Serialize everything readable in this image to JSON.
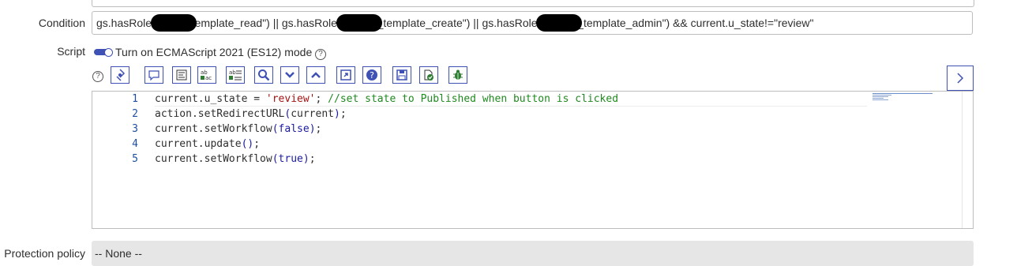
{
  "condition": {
    "label": "Condition",
    "seg1": "gs.hasRole(",
    "seg2": "template_read\") || gs.hasRole(",
    "seg3": "_template_create\") || gs.hasRole(",
    "seg4": "_template_admin\") && current.u_state!=\"review\""
  },
  "script": {
    "label": "Script",
    "es_mode_label": "Turn on ECMAScript 2021 (ES12) mode",
    "es_mode_enabled": true,
    "help_glyph": "?"
  },
  "toolbar": {
    "icons": [
      "toggle-syntax-icon",
      "comment-icon",
      "format-icon",
      "replace-icon",
      "replace-all-icon",
      "search-icon",
      "next-icon",
      "previous-icon",
      "fullscreen-icon",
      "help-icon",
      "save-icon",
      "script-debug-icon",
      "debugger-icon"
    ]
  },
  "editor": {
    "lines": [
      {
        "num": "1",
        "parts": [
          [
            "plain",
            "current.u_state = "
          ],
          [
            "str",
            "'review'"
          ],
          [
            "plain",
            "; "
          ],
          [
            "cmt",
            "//set state to Published when button is clicked"
          ]
        ]
      },
      {
        "num": "2",
        "parts": [
          [
            "plain",
            "action.setRedirectURL"
          ],
          [
            "paren",
            "("
          ],
          [
            "plain",
            "current"
          ],
          [
            "paren",
            ")"
          ],
          [
            "plain",
            ";"
          ]
        ]
      },
      {
        "num": "3",
        "parts": [
          [
            "plain",
            "current.setWorkflow"
          ],
          [
            "paren",
            "("
          ],
          [
            "bool",
            "false"
          ],
          [
            "paren",
            ")"
          ],
          [
            "plain",
            ";"
          ]
        ]
      },
      {
        "num": "4",
        "parts": [
          [
            "plain",
            "current.update"
          ],
          [
            "paren",
            "()"
          ],
          [
            "plain",
            ";"
          ]
        ]
      },
      {
        "num": "5",
        "parts": [
          [
            "plain",
            "current.setWorkflow"
          ],
          [
            "paren",
            "("
          ],
          [
            "bool",
            "true"
          ],
          [
            "paren",
            ")"
          ],
          [
            "plain",
            ";"
          ]
        ]
      }
    ]
  },
  "protection": {
    "label": "Protection policy",
    "value": "-- None --"
  },
  "colors": {
    "accent": "#3f51b5",
    "string": "#aa1111",
    "comment": "#1f8a1f",
    "keyword": "#1a1aa6"
  }
}
